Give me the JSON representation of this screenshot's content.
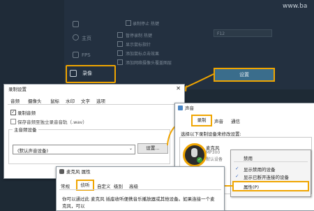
{
  "watermark": "www.ba",
  "dark_app": {
    "sidebar": [
      {
        "label": "",
        "icon": "settings-icon"
      },
      {
        "label": "主页",
        "icon": "home-icon"
      },
      {
        "label": "FPS",
        "icon": "fps-icon"
      },
      {
        "label": "录像",
        "icon": "record-icon"
      }
    ],
    "top_option": "录制停止 热键",
    "options": [
      "暂停录制 热键",
      "显示鼠标指针",
      "添加鼠标点击效果",
      "添加网络摄像头覆盖图层"
    ],
    "hotkey": "F12",
    "settings_label": "设置"
  },
  "rec_dialog": {
    "title": "录制设置",
    "tabs": [
      "音频",
      "摄像头",
      "鼠标",
      "水印",
      "文字",
      "选项"
    ],
    "record_audio": "录制音频",
    "save_separately": "保存音频至独立录音音轨（.wav）",
    "group_title": "主音频设备",
    "device_value": "(默认声音设备)",
    "settings_button": "设置..."
  },
  "sound_dialog": {
    "title": "声音",
    "tabs": [
      "录制",
      "声音",
      "通信"
    ],
    "prompt": "选择以下录制设备来修改设置:",
    "device_name": "麦克风",
    "device_sub1": "MP300",
    "device_sub2": "默认设备"
  },
  "context_menu": {
    "items": [
      "禁用",
      "显示禁用的设备",
      "显示已断开连接的设备",
      "属性(P)"
    ]
  },
  "mic_dialog": {
    "title": "麦克风 属性",
    "tabs": [
      "常规",
      "侦听",
      "自定义",
      "级别",
      "高级"
    ],
    "body_line1": "你可以通过此 麦克风 插座收听便携音乐播放器或其他设备。如果连接一个麦",
    "body_line2": "克风，可以"
  }
}
